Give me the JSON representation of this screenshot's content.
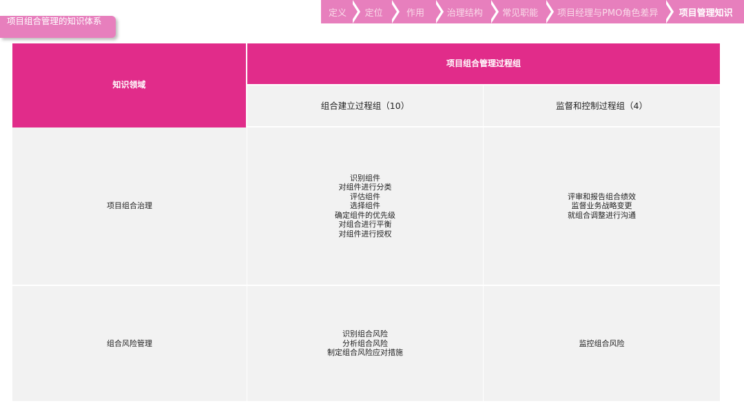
{
  "nav": {
    "items": [
      {
        "label": "定义",
        "active": false
      },
      {
        "label": "定位",
        "active": false
      },
      {
        "label": "作用",
        "active": false
      },
      {
        "label": "治理结构",
        "active": false
      },
      {
        "label": "常见职能",
        "active": false
      },
      {
        "label": "项目经理与PMO角色差异",
        "active": false
      },
      {
        "label": "项目管理知识",
        "active": true
      }
    ]
  },
  "page": {
    "title": "项目组合管理的知识体系"
  },
  "table": {
    "row_header": "知识领域",
    "group_header": "项目组合管理过程组",
    "columns": [
      "组合建立过程组（10）",
      "监督和控制过程组（4）"
    ],
    "rows": [
      {
        "area": "项目组合治理",
        "establish": [
          "识别组件",
          "对组件进行分类",
          "评估组件",
          "选择组件",
          "确定组件的优先级",
          "对组合进行平衡",
          "对组件进行授权"
        ],
        "monitor": [
          "评审和报告组合绩效",
          "监督业务战略变更",
          "就组合调整进行沟通"
        ]
      },
      {
        "area": "组合风险管理",
        "establish": [
          "识别组合风险",
          "分析组合风险",
          "制定组合风险应对措施"
        ],
        "monitor": [
          "监控组合风险"
        ]
      }
    ]
  },
  "colors": {
    "accent": "#e12c8a",
    "nav_bg": "#e77fbd",
    "cell_bg": "#f2f2f2"
  }
}
